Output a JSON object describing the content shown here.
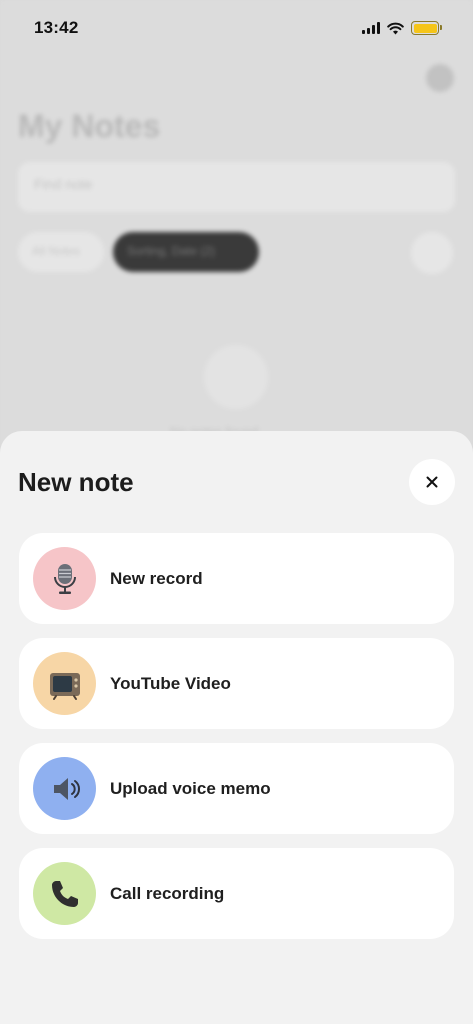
{
  "status_bar": {
    "time": "13:42"
  },
  "background": {
    "title": "My Notes",
    "search_placeholder": "Find note",
    "chip_all": "All Notes",
    "chip_active": "Sorting, Date (2)",
    "empty_text": "No notes found"
  },
  "sheet": {
    "title": "New note",
    "close_label": "×",
    "options": [
      {
        "label": "New record",
        "icon": "microphone-icon",
        "color": "#f6c5c8"
      },
      {
        "label": "YouTube Video",
        "icon": "television-icon",
        "color": "#f7d6a6"
      },
      {
        "label": "Upload voice memo",
        "icon": "speaker-icon",
        "color": "#8fb0f0"
      },
      {
        "label": "Call recording",
        "icon": "phone-icon",
        "color": "#cfe8a4"
      }
    ]
  },
  "colors": {
    "sheet_bg": "#f2f2f2",
    "card_bg": "#ffffff",
    "battery": "#f5c518"
  }
}
